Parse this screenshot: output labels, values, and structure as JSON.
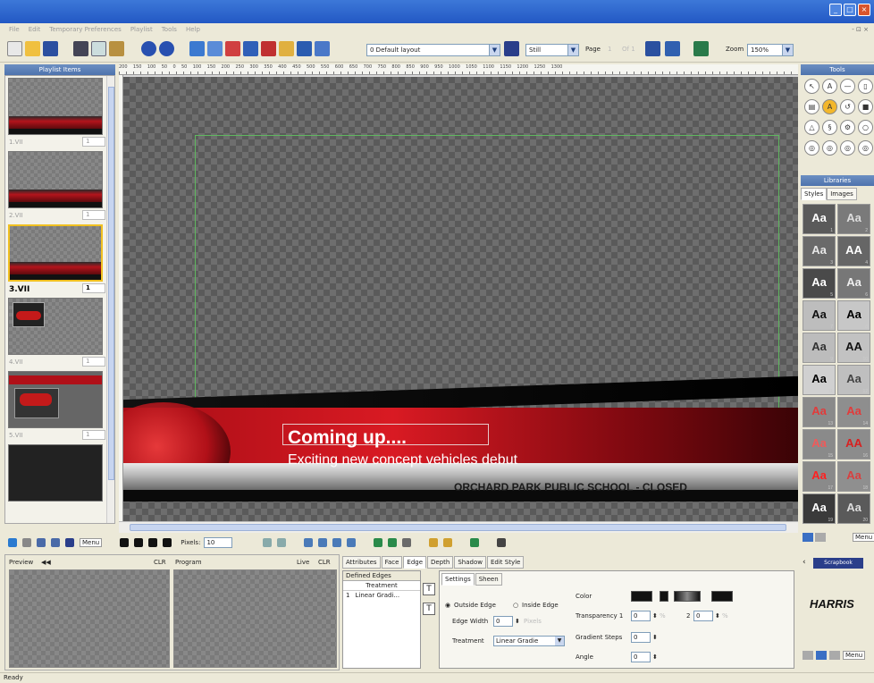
{
  "menu": {
    "items": [
      "File",
      "Edit",
      "Temporary Preferences",
      "Playlist",
      "Tools",
      "Help"
    ],
    "right": "- ⊡ ×"
  },
  "toolbar": {
    "layout_value": "0 Default layout",
    "mode_value": "Still",
    "page_label": "Page",
    "page_value": "1",
    "page_of": "Of 1",
    "zoom_label": "Zoom",
    "zoom_value": "150%"
  },
  "ruler": {
    "ticks": [
      "200",
      "150",
      "100",
      "50",
      "0",
      "50",
      "100",
      "150",
      "200",
      "250",
      "300",
      "350",
      "400",
      "450",
      "500",
      "550",
      "600",
      "650",
      "700",
      "750",
      "800",
      "850",
      "900",
      "950",
      "1000",
      "1050",
      "1100",
      "1150",
      "1200",
      "1250",
      "1300"
    ]
  },
  "playlist": {
    "header": "Playlist Items",
    "items": [
      {
        "label": "1.VII",
        "page": "1"
      },
      {
        "label": "2.VII",
        "page": "1"
      },
      {
        "label": "3.VII",
        "page": "1"
      },
      {
        "label": "4.VII",
        "page": "1"
      },
      {
        "label": "5.VII",
        "page": "1"
      }
    ]
  },
  "canvas": {
    "title": "Coming up....",
    "subtitle": "Exciting new concept vehicles debut",
    "ticker": "ORCHARD PARK PUBLIC SCHOOL - CLOSED"
  },
  "tools": {
    "header": "Tools"
  },
  "libraries": {
    "header": "Libraries",
    "tabs": [
      "Styles",
      "Images"
    ],
    "swatches": [
      {
        "text": "Aa",
        "num": "1",
        "bg": "#5a5a5a",
        "color": "#ffffff"
      },
      {
        "text": "Aa",
        "num": "2",
        "bg": "#7a7a7a",
        "color": "#dddddd"
      },
      {
        "text": "Aa",
        "num": "3",
        "bg": "#6a6a6a",
        "color": "#e8e8e8"
      },
      {
        "text": "AA",
        "num": "4",
        "bg": "#666666",
        "color": "#ffffff"
      },
      {
        "text": "Aa",
        "num": "5",
        "bg": "#4a4a4a",
        "color": "#ffffff"
      },
      {
        "text": "Aa",
        "num": "6",
        "bg": "#777777",
        "color": "#eeeeee"
      },
      {
        "text": "Aa",
        "num": "7",
        "bg": "#bdbdbd",
        "color": "#111111"
      },
      {
        "text": "Aa",
        "num": "8",
        "bg": "#c7c7c7",
        "color": "#000000"
      },
      {
        "text": "Aa",
        "num": "9",
        "bg": "#bcbcbc",
        "color": "#333333"
      },
      {
        "text": "AA",
        "num": "10",
        "bg": "#c2c2c2",
        "color": "#111111"
      },
      {
        "text": "Aa",
        "num": "11",
        "bg": "#d0d0d0",
        "color": "#000000"
      },
      {
        "text": "Aa",
        "num": "12",
        "bg": "#bfbfbf",
        "color": "#444444"
      },
      {
        "text": "Aa",
        "num": "13",
        "bg": "#8a8a8a",
        "color": "#e23b3b"
      },
      {
        "text": "Aa",
        "num": "14",
        "bg": "#8e8e8e",
        "color": "#e23b3b"
      },
      {
        "text": "Aa",
        "num": "15",
        "bg": "#8a8a8a",
        "color": "#f05a5a"
      },
      {
        "text": "AA",
        "num": "16",
        "bg": "#8c8c8c",
        "color": "#d92020"
      },
      {
        "text": "Aa",
        "num": "17",
        "bg": "#8a8a8a",
        "color": "#ff2020"
      },
      {
        "text": "Aa",
        "num": "18",
        "bg": "#8f8f8f",
        "color": "#d84040"
      },
      {
        "text": "Aa",
        "num": "19",
        "bg": "#3a3a3a",
        "color": "#ffffff"
      },
      {
        "text": "Aa",
        "num": "20",
        "bg": "#5a5a5a",
        "color": "#dddddd"
      }
    ],
    "menu_label": "Menu"
  },
  "bottom_toolbar": {
    "menu_label": "Menu",
    "pixels_label": "Pixels:",
    "pixels_value": "10"
  },
  "preview": {
    "preview_label": "Preview",
    "clr_label": "CLR",
    "program_label": "Program",
    "live_label": "Live",
    "clr2_label": "CLR"
  },
  "attributes": {
    "tabs": [
      "Attributes",
      "Face",
      "Edge",
      "Depth",
      "Shadow",
      "Edit Style"
    ],
    "active_tab": "Edge",
    "defined_edges_label": "Defined Edges",
    "treatment_col": "Treatment",
    "edge_row_num": "1",
    "edge_row_value": "Linear Gradi...",
    "settings_tabs": [
      "Settings",
      "Sheen"
    ],
    "outside_edge": "Outside Edge",
    "inside_edge": "Inside Edge",
    "edge_width_label": "Edge Width",
    "edge_width_value": "0",
    "pixels_unit": "Pixels",
    "treatment_label": "Treatment",
    "treatment_value": "Linear Gradie",
    "color_label": "Color",
    "transparency_label": "Transparency 1",
    "transparency_1": "0",
    "transparency_2_label": "2",
    "transparency_2": "0",
    "percent": "%",
    "gradient_steps_label": "Gradient Steps",
    "gradient_steps_value": "0",
    "angle_label": "Angle",
    "angle_value": "0"
  },
  "scrapbook": {
    "tab": "Scrapbook",
    "logo": "HARRIS",
    "menu_label": "Menu"
  },
  "status": {
    "text": "Ready"
  }
}
